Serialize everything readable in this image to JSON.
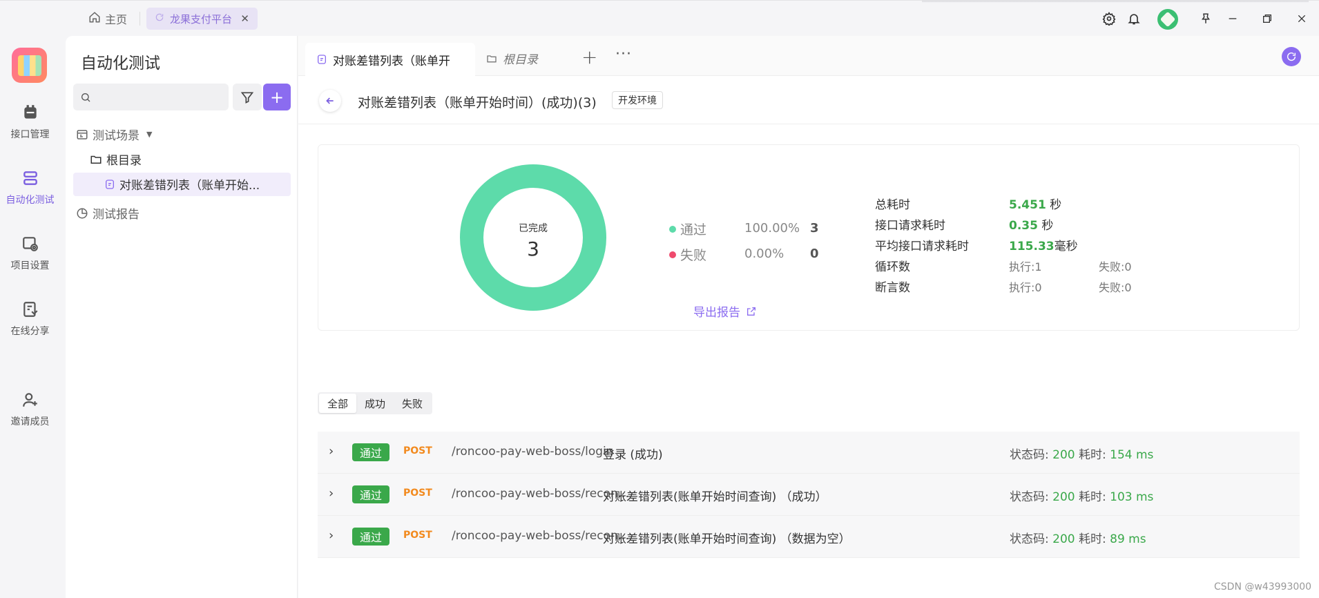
{
  "titlebar": {
    "home_label": "主页",
    "tab_label": "龙果支付平台",
    "tab_close": "✕",
    "avatar_color": "#3bbf72"
  },
  "rail": {
    "items": [
      {
        "label": "接口管理",
        "icon": "api-icon"
      },
      {
        "label": "自动化测试",
        "icon": "automation-icon"
      },
      {
        "label": "项目设置",
        "icon": "settings-icon"
      },
      {
        "label": "在线分享",
        "icon": "share-icon"
      },
      {
        "label": "邀请成员",
        "icon": "invite-icon"
      }
    ]
  },
  "sidebar": {
    "title": "自动化测试",
    "search_placeholder": "",
    "add_label": "+",
    "tree": {
      "scenes_label": "测试场景",
      "root_label": "根目录",
      "item_label": "对账差错列表（账单开始...",
      "report_label": "测试报告"
    }
  },
  "tabs": {
    "active_label": "对账差错列表（账单开",
    "second_label": "根目录",
    "plus": "+",
    "more": "···"
  },
  "header": {
    "title": "对账差错列表（账单开始时间）(成功)(3)",
    "env_badge": "开发环境"
  },
  "summary": {
    "completed_label": "已完成",
    "completed_count": "3",
    "pass_label": "通过",
    "pass_pct": "100.00%",
    "pass_count": "3",
    "fail_label": "失败",
    "fail_pct": "0.00%",
    "fail_count": "0",
    "pass_color": "#5ddbaa",
    "fail_color": "#ef4a6d",
    "pass_fraction": 1.0,
    "stats": {
      "total_time_label": "总耗时",
      "total_time_value": "5.451",
      "total_time_unit": " 秒",
      "req_time_label": "接口请求耗时",
      "req_time_value": "0.35",
      "req_time_unit": " 秒",
      "avg_time_label": "平均接口请求耗时",
      "avg_time_value": "115.33",
      "avg_time_unit": "毫秒",
      "loop_label": "循环数",
      "loop_exec": "执行:1",
      "loop_fail": "失败:0",
      "assert_label": "断言数",
      "assert_exec": "执行:0",
      "assert_fail": "失败:0"
    },
    "export_label": "导出报告"
  },
  "filters": {
    "all": "全部",
    "success": "成功",
    "fail": "失败"
  },
  "rows": [
    {
      "status": "通过",
      "method": "POST",
      "path": "/roncoo-pay-web-boss/login",
      "name": "登录 (成功)",
      "code_label": "状态码: ",
      "code": "200",
      "time_label": "  耗时: ",
      "time": "154 ms"
    },
    {
      "status": "通过",
      "method": "POST",
      "path": "/roncoo-pay-web-boss/recon...",
      "name": "对账差错列表(账单开始时间查询) （成功）",
      "code_label": "状态码: ",
      "code": "200",
      "time_label": "  耗时: ",
      "time": "103 ms"
    },
    {
      "status": "通过",
      "method": "POST",
      "path": "/roncoo-pay-web-boss/recon...",
      "name": "对账差错列表(账单开始时间查询) （数据为空）",
      "code_label": "状态码: ",
      "code": "200",
      "time_label": "  耗时: ",
      "time": "89 ms"
    }
  ],
  "watermark": "CSDN @w43993000"
}
